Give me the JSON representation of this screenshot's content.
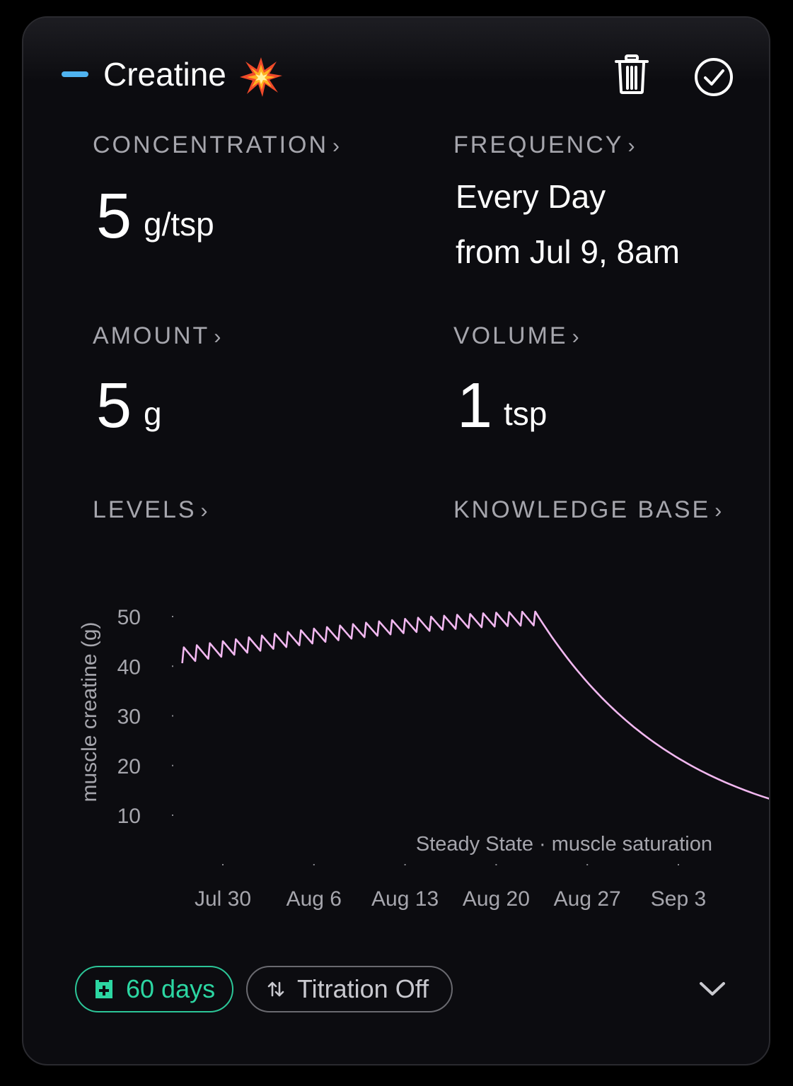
{
  "header": {
    "title": "Creatine",
    "accent_color": "#4fb3f0",
    "title_emoji_icon": "collision-spark-icon",
    "delete_icon": "trash-icon",
    "confirm_icon": "check-circle-icon"
  },
  "concentration": {
    "label": "CONCENTRATION",
    "value": "5",
    "unit": "g/tsp"
  },
  "frequency": {
    "label": "FREQUENCY",
    "line1": "Every Day",
    "line2": "from Jul 9, 8am"
  },
  "amount": {
    "label": "AMOUNT",
    "value": "5",
    "unit": "g"
  },
  "volume": {
    "label": "VOLUME",
    "value": "1",
    "unit": "tsp"
  },
  "levels": {
    "label": "LEVELS"
  },
  "knowledge": {
    "label": "KNOWLEDGE BASE"
  },
  "chevron": "›",
  "chart_data": {
    "type": "line",
    "ylabel": "muscle creatine (g)",
    "yticks": [
      50,
      40,
      30,
      20,
      10
    ],
    "xticks": [
      "Jul 30",
      "Aug 6",
      "Aug 13",
      "Aug 20",
      "Aug 27",
      "Sep 3"
    ],
    "annotation": "Steady State · muscle saturation",
    "line_color": "#f2b8f0",
    "ylim": [
      10,
      50
    ],
    "series": [
      {
        "dose_start": "Jul 27",
        "dose_end": "Aug 23",
        "peak_start": 43.8,
        "trough_start": 40.6,
        "peak_end": 51.0,
        "trough_end": 48.2,
        "end_date": "Sep 11",
        "end_value": 12.5
      }
    ]
  },
  "footer": {
    "duration_label": "60 days",
    "duration_icon": "pill-box-icon",
    "duration_color": "#2cd6a2",
    "titration_label": "Titration Off",
    "titration_icon": "swap-vertical-icon",
    "expand_icon": "chevron-down-icon"
  }
}
